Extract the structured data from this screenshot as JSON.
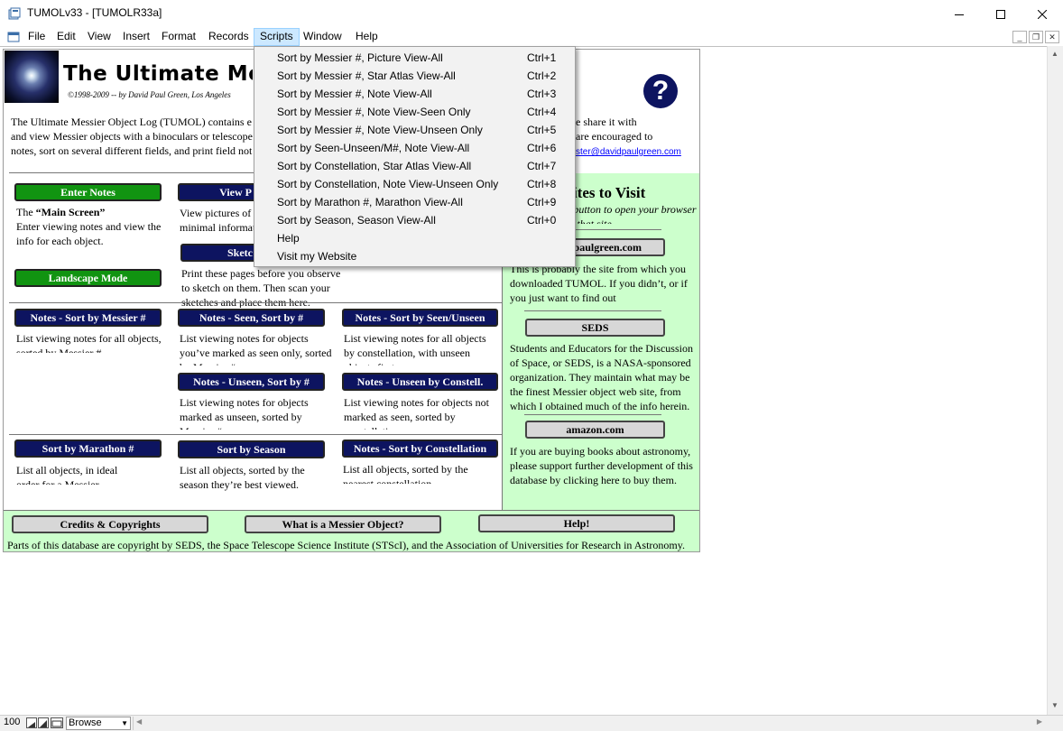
{
  "window": {
    "title": "TUMOLv33 - [TUMOLR33a]"
  },
  "menubar": {
    "items": [
      "File",
      "Edit",
      "View",
      "Insert",
      "Format",
      "Records",
      "Scripts",
      "Window",
      "Help"
    ],
    "active": "Scripts"
  },
  "header": {
    "title": "The Ultimate Messier Object Log",
    "copyright": "©1998-2009  --  by David Paul Green, Los Angeles",
    "help_glyph": "?"
  },
  "intro": {
    "line1": "The Ultimate Messier Object Log (TUMOL) contains e",
    "line2": "and view Messier objects with a binoculars or telescope",
    "line3": "notes, sort on several different fields, and print field not",
    "right1": "e share it with",
    "right2": "are encouraged to",
    "email": "ster@davidpaulgreen.com"
  },
  "main_buttons": {
    "enter_notes": "Enter Notes",
    "main_screen_prefix": "The ",
    "main_screen_bold": "“Main Screen”",
    "enter_notes_desc": "Enter viewing notes and view the info for each object.",
    "landscape": "Landscape Mode",
    "view_pictures": "View P",
    "view_pictures_desc": "View pictures of minimal informat",
    "sketch": "Sketc",
    "sketch_desc": "Print these pages before you observe to sketch on them. Then scan your sketches and place them here."
  },
  "notes_buttons": [
    {
      "label": "Notes - Sort by Messier #",
      "desc": "List viewing notes for all objects, sorted by Messier #."
    },
    {
      "label": "Notes - Seen, Sort by #",
      "desc": "List viewing notes for objects you’ve marked as seen only, sorted by Messier #."
    },
    {
      "label": "Notes - Sort by Seen/Unseen",
      "desc": "List  viewing notes for all objects by constellation, with unseen objects first."
    },
    {
      "label": "Notes - Unseen, Sort by #",
      "desc": "List viewing notes for objects marked as unseen, sorted by Messier #."
    },
    {
      "label": "Notes - Unseen by Constell.",
      "desc": "List viewing notes for objects not marked as seen, sorted by constellation."
    }
  ],
  "sort_buttons": [
    {
      "label": "Sort by Marathon #",
      "desc": "List all objects, in ideal order  for a Messier marathon."
    },
    {
      "label": "Sort by Season",
      "desc": "List all objects, sorted by the season they’re best viewed."
    },
    {
      "label": "Notes - Sort by Constellation",
      "desc": "List all objects, sorted by the nearest  constellation."
    }
  ],
  "websites": {
    "title": "ites to Visit",
    "subtitle": "k button to open your browser to that site.",
    "sites": [
      {
        "label": "paulgreen.com",
        "desc": "This is probably the site from which you downloaded TUMOL. If you didn’t, or if you just want to find out"
      },
      {
        "label": "SEDS",
        "desc": "Students and Educators for the Discussion of Space, or SEDS, is a NASA-sponsored organization. They maintain what may be the finest Messier object web site, from which I obtained much of the info herein."
      },
      {
        "label": "amazon.com",
        "desc": "If you are buying books about astronomy, please support further development of this database by clicking here to buy them."
      }
    ]
  },
  "footer": {
    "credits": "Credits & Copyrights",
    "what_is": "What is a Messier Object?",
    "help": "Help!",
    "note": "Parts of this database are copyright by SEDS, the Space Telescope Science Institute (STScI), and the Association of  Universities for Research in Astronomy."
  },
  "scripts_menu": [
    {
      "label": "Sort by Messier #, Picture View-All",
      "shortcut": "Ctrl+1"
    },
    {
      "label": "Sort by Messier #, Star Atlas View-All",
      "shortcut": "Ctrl+2"
    },
    {
      "label": "Sort by Messier #, Note View-All",
      "shortcut": "Ctrl+3"
    },
    {
      "label": "Sort by Messier #, Note View-Seen Only",
      "shortcut": "Ctrl+4"
    },
    {
      "label": "Sort by Messier #, Note View-Unseen Only",
      "shortcut": "Ctrl+5"
    },
    {
      "label": "Sort by Seen-Unseen/M#, Note View-All",
      "shortcut": "Ctrl+6"
    },
    {
      "label": "Sort by Constellation, Star Atlas View-All",
      "shortcut": "Ctrl+7"
    },
    {
      "label": "Sort by Constellation, Note View-Unseen Only",
      "shortcut": "Ctrl+8"
    },
    {
      "label": "Sort by Marathon #, Marathon View-All",
      "shortcut": "Ctrl+9"
    },
    {
      "label": "Sort by Season, Season View-All",
      "shortcut": "Ctrl+0"
    },
    {
      "label": "Help",
      "shortcut": ""
    },
    {
      "label": "Visit my Website",
      "shortcut": ""
    }
  ],
  "statusbar": {
    "zoom": "100",
    "mode": "Browse"
  },
  "colors": {
    "navy": "#0d1460",
    "green": "#119411",
    "web_panel": "#ccffcc",
    "menu_highlight": "#cce8ff"
  }
}
